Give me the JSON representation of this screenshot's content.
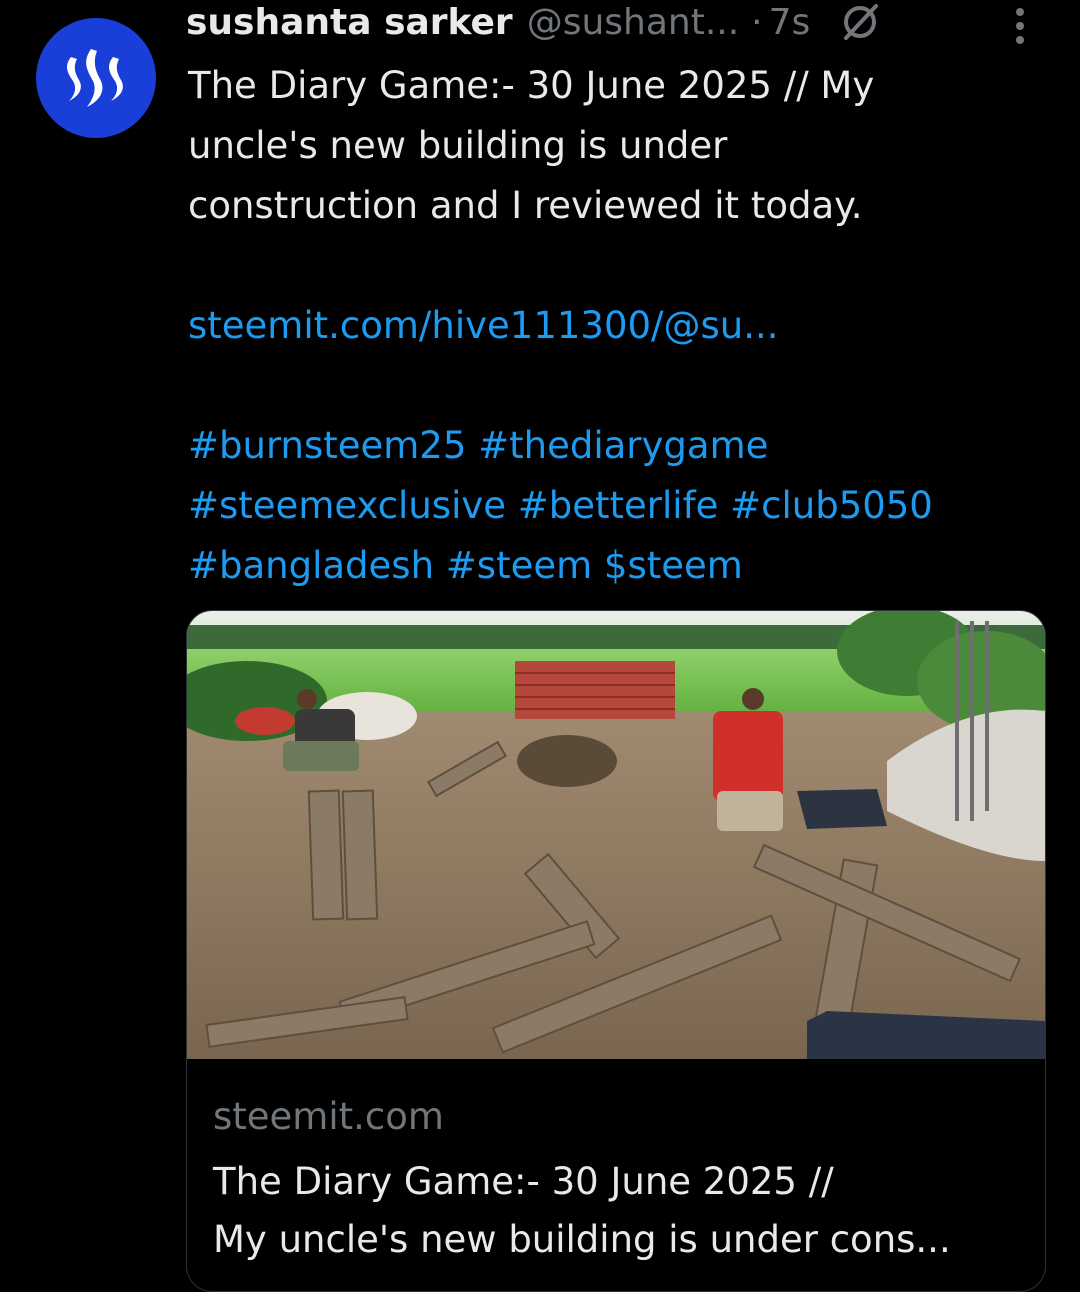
{
  "author": {
    "name": "sushanta sarker",
    "handle": "@sushant...",
    "separator": "·",
    "time": "7s"
  },
  "tweet": {
    "lines": [
      "The Diary Game:- 30 June 2025 // My",
      "uncle's new building is under",
      "construction and I reviewed it today."
    ],
    "link": "steemit.com/hive111300/@su...",
    "hashtag_lines": [
      "#burnsteem25 #thediarygame",
      "#steemexclusive #betterlife #club5050",
      "#bangladesh #steem $steem"
    ]
  },
  "card": {
    "domain": "steemit.com",
    "title_lines": [
      "The Diary Game:- 30 June 2025 //",
      "My uncle's new building is under cons..."
    ]
  },
  "icons": {
    "avatar": "steem-logo-icon",
    "edit": "no-edit-icon",
    "menu": "more-vertical-icon"
  },
  "colors": {
    "background": "#000000",
    "text": "#e7e9ea",
    "muted": "#71767b",
    "link": "#1d9bf0",
    "avatar": "#1a3fd8"
  }
}
